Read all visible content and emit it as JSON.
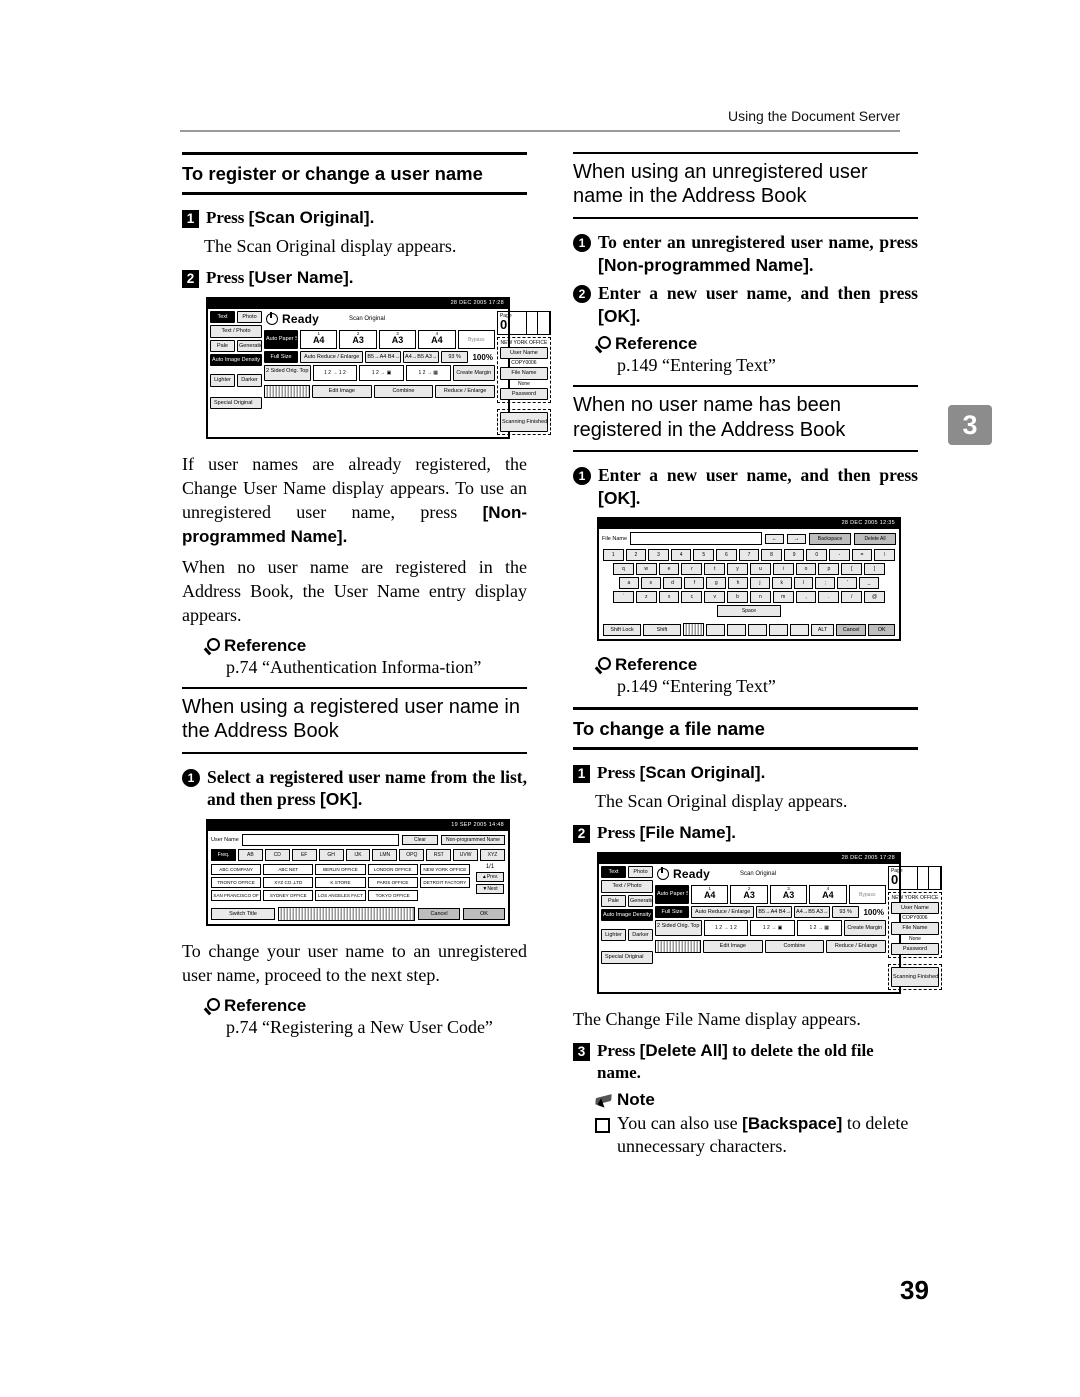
{
  "running_header": "Using the Document Server",
  "chapter_tab": "3",
  "page_number": "39",
  "left_column": {
    "section_heading": "To register or change a user name",
    "step1": {
      "num": "1",
      "text_pre": "Press ",
      "text_bold": "[Scan Original]."
    },
    "step1_body": "The Scan Original display appears.",
    "step2": {
      "num": "2",
      "text_pre": "Press ",
      "text_bold": "[User Name]."
    },
    "para1_a": "If user names are already registered, the Change User Name display appears. To use an unregistered user name, press ",
    "para1_b": "[Non-programmed Name]",
    "para1_c": ".",
    "para2": "When no user name are registered in the Address Book, the User Name entry display appears.",
    "reference_label": "Reference",
    "reference_1": "p.74 “Authentication Informa-tion”",
    "subheading_registered": "When using a registered user name in the Address Book",
    "cstep1_a": "Select a registered user name from the list, and then press ",
    "cstep1_b": "[OK]",
    "cstep1_c": ".",
    "para3": "To change your user name to an unregistered user name, proceed to the next step.",
    "reference_2": "p.74 “Registering a New User Code”"
  },
  "right_column": {
    "subheading_unregistered": "When using an unregistered user name in the Address Book",
    "cstep1_a": "To enter an unregistered user name, press ",
    "cstep1_b": "[Non-programmed Name]",
    "cstep1_c": ".",
    "cstep2_a": "Enter a new user name, and then press ",
    "cstep2_b": "[OK]",
    "cstep2_c": ".",
    "reference_label": "Reference",
    "reference_1": "p.149 “Entering Text”",
    "subheading_nouser": "When no user name has been registered in the Address Book",
    "cstep3_a": "Enter a new user name, and then press ",
    "cstep3_b": "[OK]",
    "cstep3_c": ".",
    "reference_2": "p.149 “Entering Text”",
    "section_heading": "To change a file name",
    "step1": {
      "num": "1",
      "text_pre": "Press ",
      "text_bold": "[Scan Original]."
    },
    "step1_body": "The Scan Original display appears.",
    "step2": {
      "num": "2",
      "text_pre": "Press ",
      "text_bold": "[File Name]."
    },
    "para_changefile": "The Change File Name display appears.",
    "step3": {
      "num": "3",
      "text_a": "Press ",
      "text_b": "[Delete All]",
      "text_c": " to delete the old file name."
    },
    "note_label": "Note",
    "note_item_a": "You can also use ",
    "note_item_b": "[Backspace]",
    "note_item_c": " to delete unnecessary characters."
  },
  "lcd_scan_original": {
    "timestamp": "28 DEC 2005 17:28",
    "status": "Ready",
    "mode_label": "Scan Original",
    "left_buttons": [
      "Text",
      "Photo",
      "Text / Photo",
      "Pale",
      "Generation",
      "Auto Image Density",
      "Lighter",
      "Darker",
      "Special Original"
    ],
    "auto_paper_select": "Auto Paper Select",
    "trays": [
      {
        "n": "1",
        "size": "A4"
      },
      {
        "n": "2",
        "size": "A3"
      },
      {
        "n": "3",
        "size": "A3"
      },
      {
        "n": "4",
        "size": "A4"
      }
    ],
    "bypass": "Bypass",
    "full_size": "Full Size",
    "auto_reduce": "Auto Reduce / Enlarge",
    "ratio1": "B5→A4 B4→A3",
    "ratio2": "A4→B5 A3→B4",
    "ratio3": "93 %",
    "zoom": "100%",
    "duplex": "2 Sided Orig. Top to Top",
    "create_margin": "Create Margin",
    "bottom_buttons": [
      "Edit Image",
      "Combine",
      "Reduce / Enlarge"
    ],
    "page_label": "Page",
    "page_value": "0",
    "user_name_value": "NEW YORK OFFICE",
    "user_name_button": "User Name",
    "file_name_value": "COPY0006",
    "file_name_button": "File Name",
    "password_value": "None",
    "password_button": "Password",
    "scanning_finished": "Scanning Finished"
  },
  "lcd_user_list": {
    "timestamp": "19 SEP 2005 14:48",
    "field_label": "User Name",
    "clear_button": "Clear",
    "nonprogrammed_button": "Non-programmed Name",
    "tabs": [
      "Freq.",
      "AB",
      "CD",
      "EF",
      "GH",
      "IJK",
      "LMN",
      "OPQ",
      "RST",
      "UVW",
      "XYZ"
    ],
    "selected_tab": "Freq.",
    "entries": [
      "ABC COMPANY",
      "ABC NET",
      "BERLIN OFFICE",
      "LONDON OFFICE",
      "NEW YORK OFFICE",
      "TRONTO OFFICE",
      "XYZ CO.,LTD",
      "K STORE",
      "PARIS OFFICE",
      "DETROIT FACTORY",
      "SAN FRANCISCO OF",
      "SYDNEY OFFICE",
      "LOS ANGELES FACT",
      "TOKYO OFFICE"
    ],
    "page_indicator": "1/1",
    "prev_button": "▲Prev.",
    "next_button": "▼Next",
    "switch_title": "Switch Title",
    "cancel_button": "Cancel",
    "ok_button": "OK"
  },
  "lcd_keyboard": {
    "timestamp": "28 DEC 2005 12:35",
    "field_label": "File Name",
    "left_arrow": "←",
    "right_arrow": "→",
    "backspace_button": "Backspace",
    "delete_all_button": "Delete All",
    "row1": [
      "1",
      "2",
      "3",
      "4",
      "5",
      "6",
      "7",
      "8",
      "9",
      "0",
      "-",
      "=",
      "\\"
    ],
    "row2": [
      "q",
      "w",
      "e",
      "r",
      "t",
      "y",
      "u",
      "i",
      "o",
      "p",
      "[",
      "]"
    ],
    "row3": [
      "a",
      "s",
      "d",
      "f",
      "g",
      "h",
      "j",
      "k",
      "l",
      ";",
      "'",
      "_"
    ],
    "row4": [
      "`",
      "z",
      "x",
      "c",
      "v",
      "b",
      "n",
      "m",
      ",",
      ".",
      "/",
      "@"
    ],
    "space_key": "Space",
    "shift_lock": "Shift Lock",
    "shift": "Shift",
    "alt": "ALT",
    "cancel_button": "Cancel",
    "ok_button": "OK"
  }
}
